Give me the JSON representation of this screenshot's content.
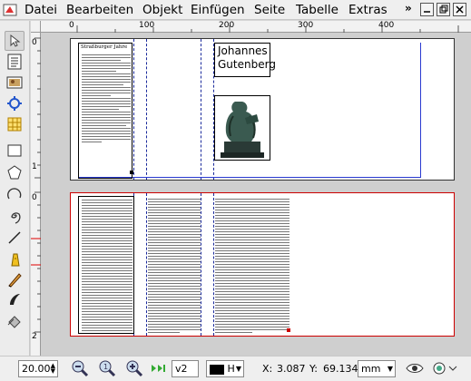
{
  "menu": {
    "items": [
      {
        "label": "Datei"
      },
      {
        "label": "Bearbeiten"
      },
      {
        "label": "Objekt"
      },
      {
        "label": "Einfügen"
      },
      {
        "label": "Seite"
      },
      {
        "label": "Tabelle"
      },
      {
        "label": "Extras"
      }
    ],
    "overflow": "»"
  },
  "tools": [
    "select-tool-icon",
    "text-frame-icon",
    "image-frame-icon",
    "render-frame-icon",
    "table-icon",
    "rectangle-icon",
    "polygon-icon",
    "arc-icon",
    "spiral-icon",
    "line-icon",
    "bezier-icon",
    "freehand-icon",
    "calligraphy-icon",
    "rotate-icon"
  ],
  "ruler": {
    "top": [
      "0",
      "100",
      "200",
      "300",
      "400"
    ],
    "left": [
      "0",
      "1",
      "0",
      "2"
    ]
  },
  "document": {
    "page1": {
      "article_title": "Straßburger Jahre",
      "heading": "Johannes Gutenberg"
    }
  },
  "statusbar": {
    "zoom": "20.00",
    "page": "v2",
    "layer": "H",
    "x_label": "X:",
    "x_value": "3.087",
    "y_label": "Y:",
    "y_value": "69.134",
    "unit": "mm"
  },
  "colors": {
    "page_border_selected": "#cc0000",
    "guide": "#1a2a9c"
  }
}
